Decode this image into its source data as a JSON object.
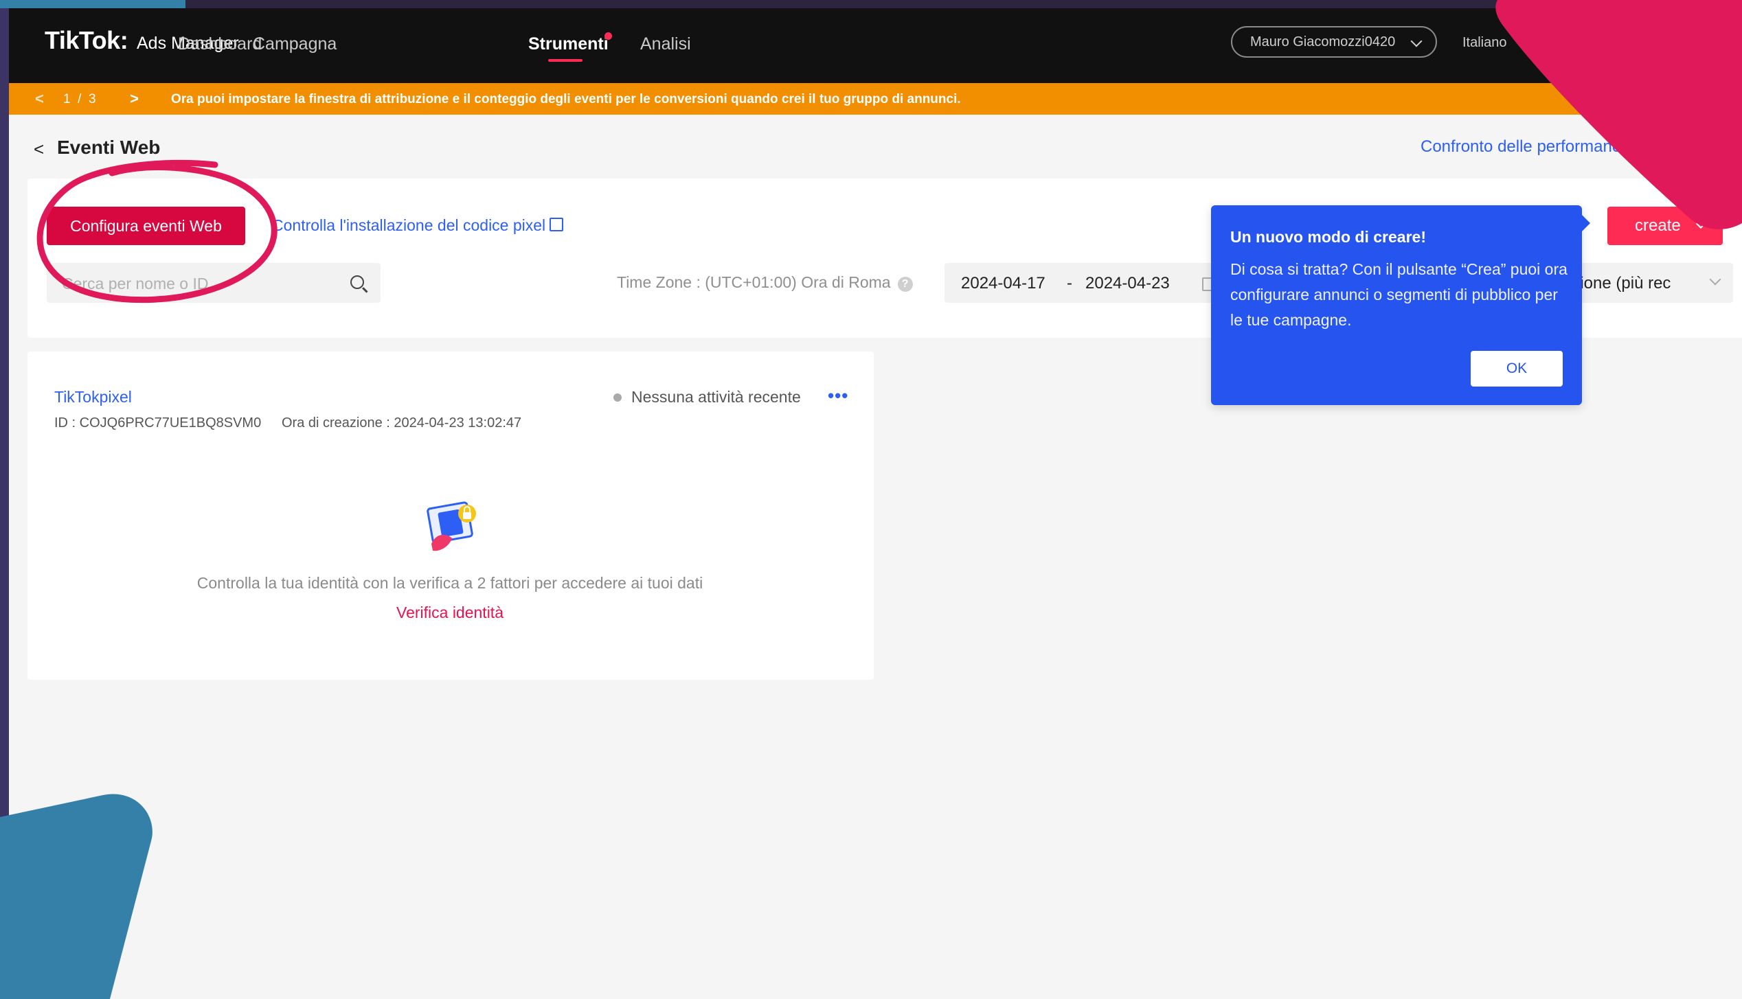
{
  "header": {
    "logo": "TikTok",
    "logo_colon": ":",
    "product": "Ads Manager",
    "nav": [
      "Dashboard",
      "Campagna",
      "Strumenti",
      "Analisi"
    ],
    "account": "Mauro Giacomozzi0420",
    "language": "Italiano"
  },
  "banner": {
    "prev": "<",
    "pager": "1  /  3",
    "next": ">",
    "message": "Ora puoi impostare la finestra di attribuzione e il conteggio degli eventi per le conversioni quando crei il tuo gruppo di annunci."
  },
  "page": {
    "back": "<",
    "title": "Eventi Web",
    "perf_link": "Confronto delle performance"
  },
  "toolbar": {
    "config_button": "Configura eventi Web",
    "pixel_check_link": "Controlla l'installazione del codice pixel",
    "search_placeholder": "Cerca per nome o ID",
    "timezone": "Time Zone : (UTC+01:00) Ora di Roma",
    "help": "?",
    "date_start": "2024-04-17",
    "date_sep": "-",
    "date_end": "2024-04-23",
    "sort": "azione (più rec",
    "create_button": "create"
  },
  "popover": {
    "title": "Un nuovo modo di creare!",
    "body": "Di cosa si tratta? Con il pulsante “Crea” puoi ora configurare annunci o segmenti di pubblico per le tue campagne.",
    "ok": "OK"
  },
  "pixel": {
    "name": "TikTokpixel",
    "id": "ID : COJQ6PRC77UE1BQ8SVM0",
    "created": "Ora di creazione : 2024-04-23 13:02:47",
    "status": "Nessuna attività recente",
    "more": "•••",
    "verify_message": "Controlla la tua identità con la verifica a 2 fattori per accedere ai tuoi dati",
    "verify_link": "Verifica identità"
  },
  "colors": {
    "brand_red": "#fe2c55",
    "config_red": "#d6083f",
    "link_blue": "#2d5ff5",
    "popover_blue": "#2654ee",
    "banner_orange": "#f18f01",
    "annotation_circle": "#e0195a",
    "deco_pink": "#e0195a",
    "deco_blue": "#3580a8"
  },
  "icons": [
    "search-icon",
    "calendar-icon",
    "help-icon",
    "external-link-icon",
    "chevron-down-icon",
    "back-arrow-icon",
    "more-icon",
    "verify-identity-icon"
  ]
}
